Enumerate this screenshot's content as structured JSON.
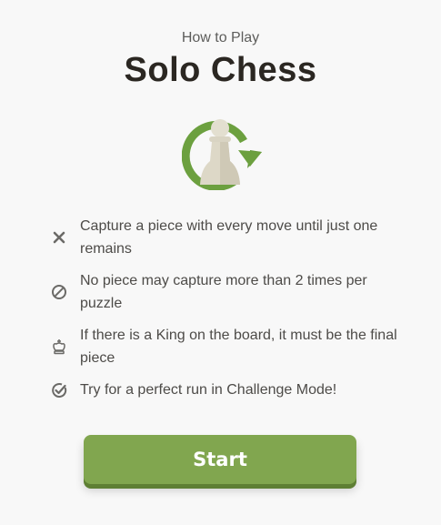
{
  "header": {
    "subtitle": "How to Play",
    "title": "Solo Chess"
  },
  "hero": {
    "icon": "pawn-with-circular-arrow-icon",
    "colors": {
      "arrow": "#6ca03f",
      "pawn": "#d9d4c3"
    }
  },
  "rules": [
    {
      "icon": "x-icon",
      "text": "Capture a piece with every move until just one remains"
    },
    {
      "icon": "no-symbol-icon",
      "text": "No piece may capture more than 2 times per puzzle"
    },
    {
      "icon": "king-icon",
      "text": "If there is a King on the board, it must be the final piece"
    },
    {
      "icon": "check-circle-icon",
      "text": "Try for a perfect run in Challenge Mode!"
    }
  ],
  "start": {
    "label": "Start",
    "color": "#81a64f"
  }
}
